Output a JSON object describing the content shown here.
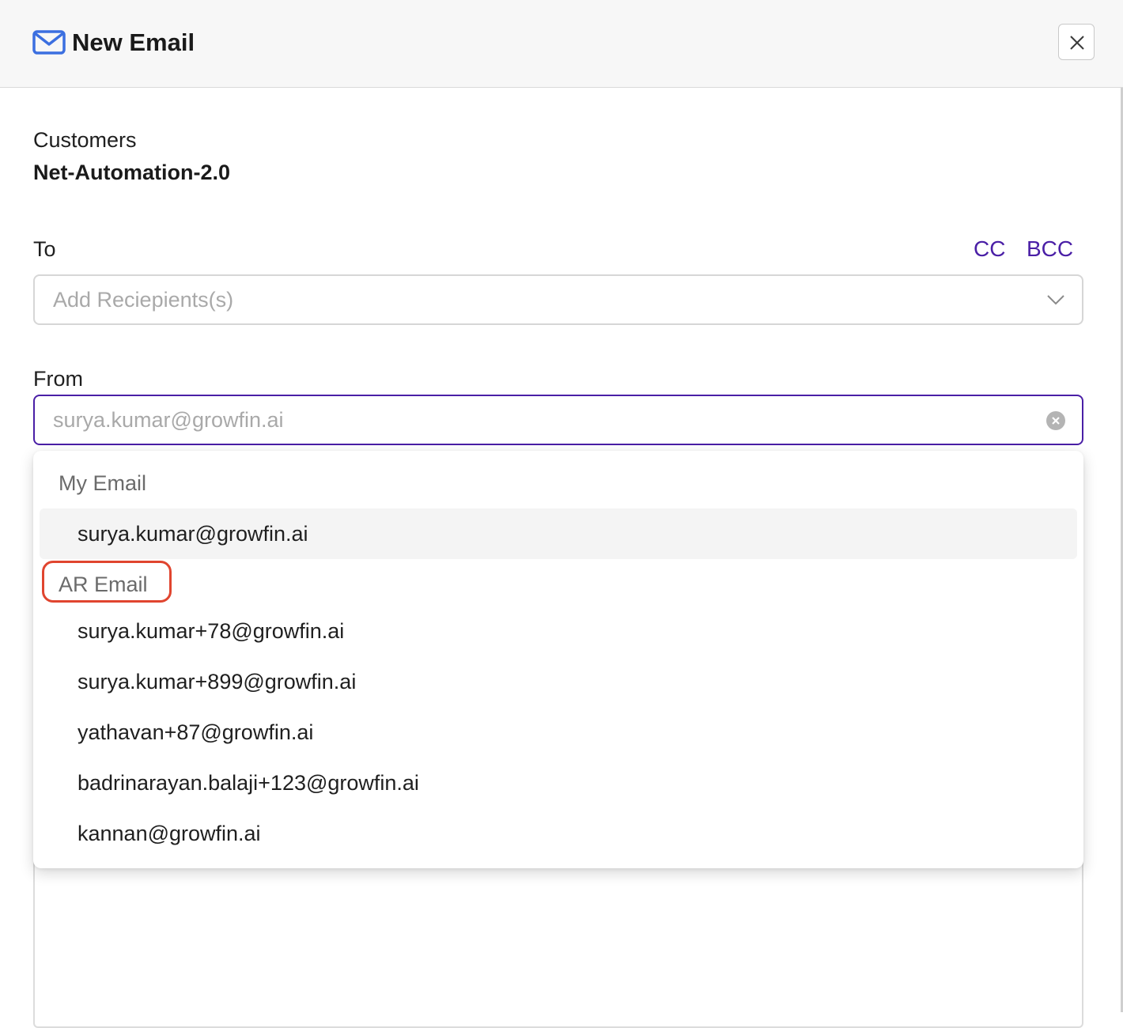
{
  "header": {
    "icon": "mail-icon",
    "title": "New Email",
    "close_icon": "close-icon"
  },
  "customers": {
    "label": "Customers",
    "value": "Net-Automation-2.0"
  },
  "to": {
    "label": "To",
    "cc_label": "CC",
    "bcc_label": "BCC",
    "placeholder": "Add Reciepients(s)"
  },
  "from": {
    "label": "From",
    "value": "surya.kumar@growfin.ai"
  },
  "dropdown": {
    "groups": [
      {
        "label": "My Email",
        "options": [
          "surya.kumar@growfin.ai"
        ]
      },
      {
        "label": "AR Email",
        "options": [
          "surya.kumar+78@growfin.ai",
          "surya.kumar+899@growfin.ai",
          "yathavan+87@growfin.ai",
          "badrinarayan.balaji+123@growfin.ai",
          "kannan@growfin.ai"
        ]
      }
    ],
    "selected": "surya.kumar@growfin.ai"
  },
  "colors": {
    "accent": "#4a1fa6",
    "mail_icon": "#3b6fe0",
    "annotation": "#e0452f",
    "header_bg": "#f7f7f7"
  }
}
